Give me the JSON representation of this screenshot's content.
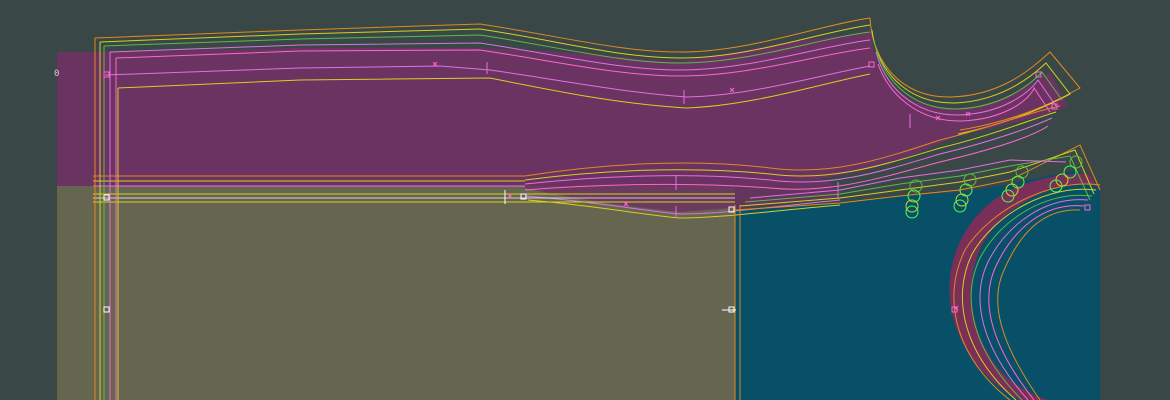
{
  "workspace": {
    "background": "#3a4747",
    "grading_marker": "0"
  },
  "colors": {
    "purple_piece": "#6b3362",
    "olive_piece": "#666650",
    "teal_piece": "#075068",
    "orange_line": "#e08a1e",
    "yellow_line": "#d6d020",
    "green_line": "#5db84a",
    "magenta_line": "#e070e0",
    "pink_line": "#ff66cc",
    "notch_color": "#4dff4d",
    "marker_color": "#d0d0d0"
  }
}
